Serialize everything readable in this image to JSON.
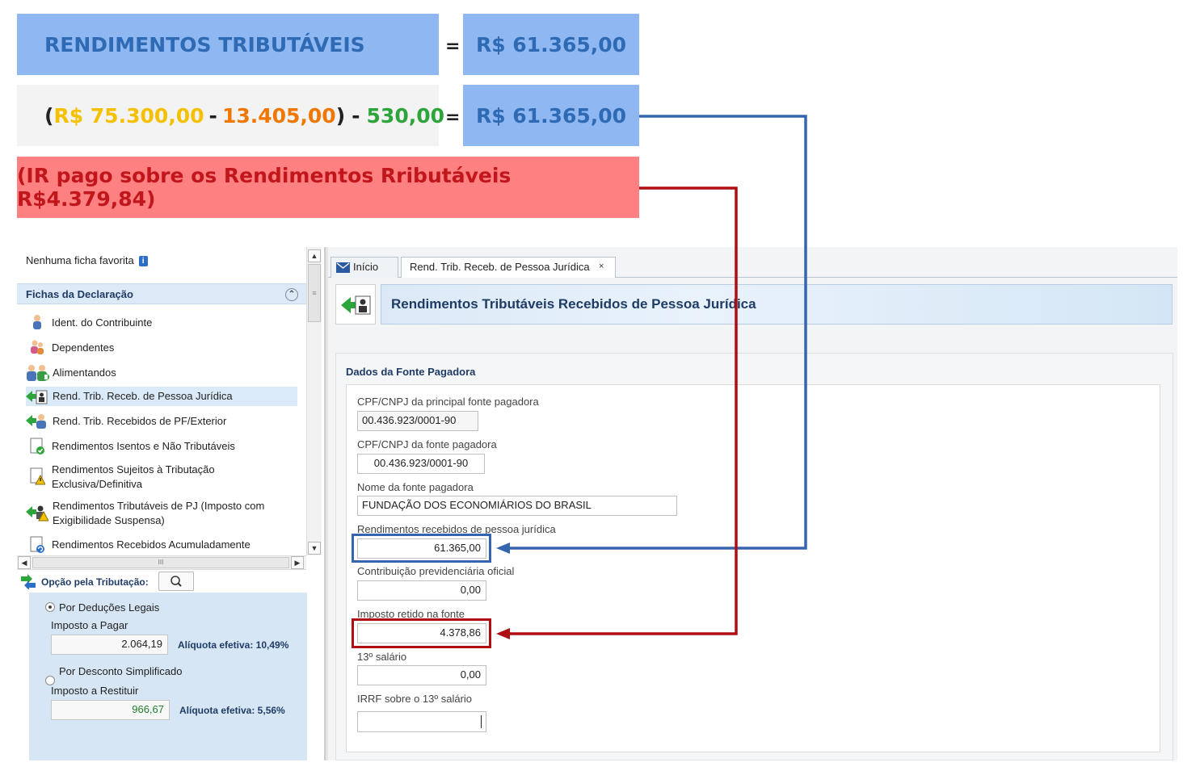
{
  "summary": {
    "row1": {
      "label": "RENDIMENTOS TRIBUTÁVEIS",
      "equals": "=",
      "result": "R$ 61.365,00"
    },
    "row2": {
      "open_paren": "(",
      "gross": "R$ 75.300,00",
      "minus1": "-",
      "deduction": "13.405,00",
      "close_paren": ")",
      "minus2": "-",
      "contribution": "530,00",
      "equals": "=",
      "result": "R$ 61.365,00"
    },
    "row3": {
      "text": "(IR pago sobre os Rendimentos Rributáveis R$4.379,84)"
    }
  },
  "sidebar": {
    "favorites_text": "Nenhuma ficha favorita",
    "section_title": "Fichas da Declaração",
    "items": [
      {
        "label": "Ident. do Contribuinte",
        "icon": "person-icon"
      },
      {
        "label": "Dependentes",
        "icon": "dependents-icon"
      },
      {
        "label": "Alimentandos",
        "icon": "alimentandos-icon"
      },
      {
        "label": "Rend. Trib. Receb. de Pessoa Jurídica",
        "icon": "rend-pj-icon"
      },
      {
        "label": "Rend. Trib. Recebidos de PF/Exterior",
        "icon": "rend-pf-icon"
      },
      {
        "label": "Rendimentos Isentos e Não Tributáveis",
        "icon": "check-doc-icon"
      },
      {
        "label1": "Rendimentos Sujeitos à Tributação",
        "label2": "Exclusiva/Definitiva",
        "icon": "warning-doc-icon"
      },
      {
        "label1": "Rendimentos Tributáveis de PJ (Imposto com",
        "label2": "Exigibilidade Suspensa)",
        "icon": "warning-pj-icon"
      },
      {
        "label": "Rendimentos Recebidos Acumuladamente",
        "icon": "refresh-doc-icon"
      }
    ],
    "hscroll_grip": "III"
  },
  "opcao": {
    "title": "Opção pela Tributação:",
    "legal": {
      "label": "Por Deduções Legais",
      "sublabel": "Imposto a Pagar",
      "value": "2.064,19",
      "aliquota": "Alíquota efetiva: 10,49%"
    },
    "simplificado": {
      "label": "Por Desconto Simplificado",
      "sublabel": "Imposto a Restituir",
      "value": "966,67",
      "aliquota": "Alíquota efetiva: 5,56%"
    }
  },
  "tabs": {
    "home": "Início",
    "active": "Rend. Trib. Receb. de Pessoa Jurídica",
    "close": "×"
  },
  "page": {
    "title": "Rendimentos Tributáveis Recebidos de Pessoa Jurídica",
    "section": "Dados da Fonte Pagadora",
    "fields": {
      "cnpj_principal": {
        "label": "CPF/CNPJ da principal fonte pagadora",
        "value": "00.436.923/0001-90"
      },
      "cnpj_fonte": {
        "label": "CPF/CNPJ da fonte pagadora",
        "value": "00.436.923/0001-90"
      },
      "nome_fonte": {
        "label": "Nome da fonte pagadora",
        "value": "FUNDAÇÃO DOS ECONOMIÁRIOS DO BRASIL"
      },
      "rendimentos": {
        "label": "Rendimentos recebidos de pessoa jurídica",
        "value": "61.365,00"
      },
      "contribuicao": {
        "label": "Contribuição previdenciária oficial",
        "value": "0,00"
      },
      "imposto_retido": {
        "label": "Imposto retido na fonte",
        "value": "4.378,86"
      },
      "decimo_terceiro": {
        "label": "13º salário",
        "value": "0,00"
      },
      "irrf_13": {
        "label": "IRRF sobre o 13º salário",
        "value": ""
      }
    }
  },
  "colors": {
    "blue_banner": "#8fb8f2",
    "gray_banner": "#f3f3f3",
    "red_banner": "#ff8080",
    "blue_arrow": "#3565ae",
    "red_arrow": "#b00d12"
  }
}
